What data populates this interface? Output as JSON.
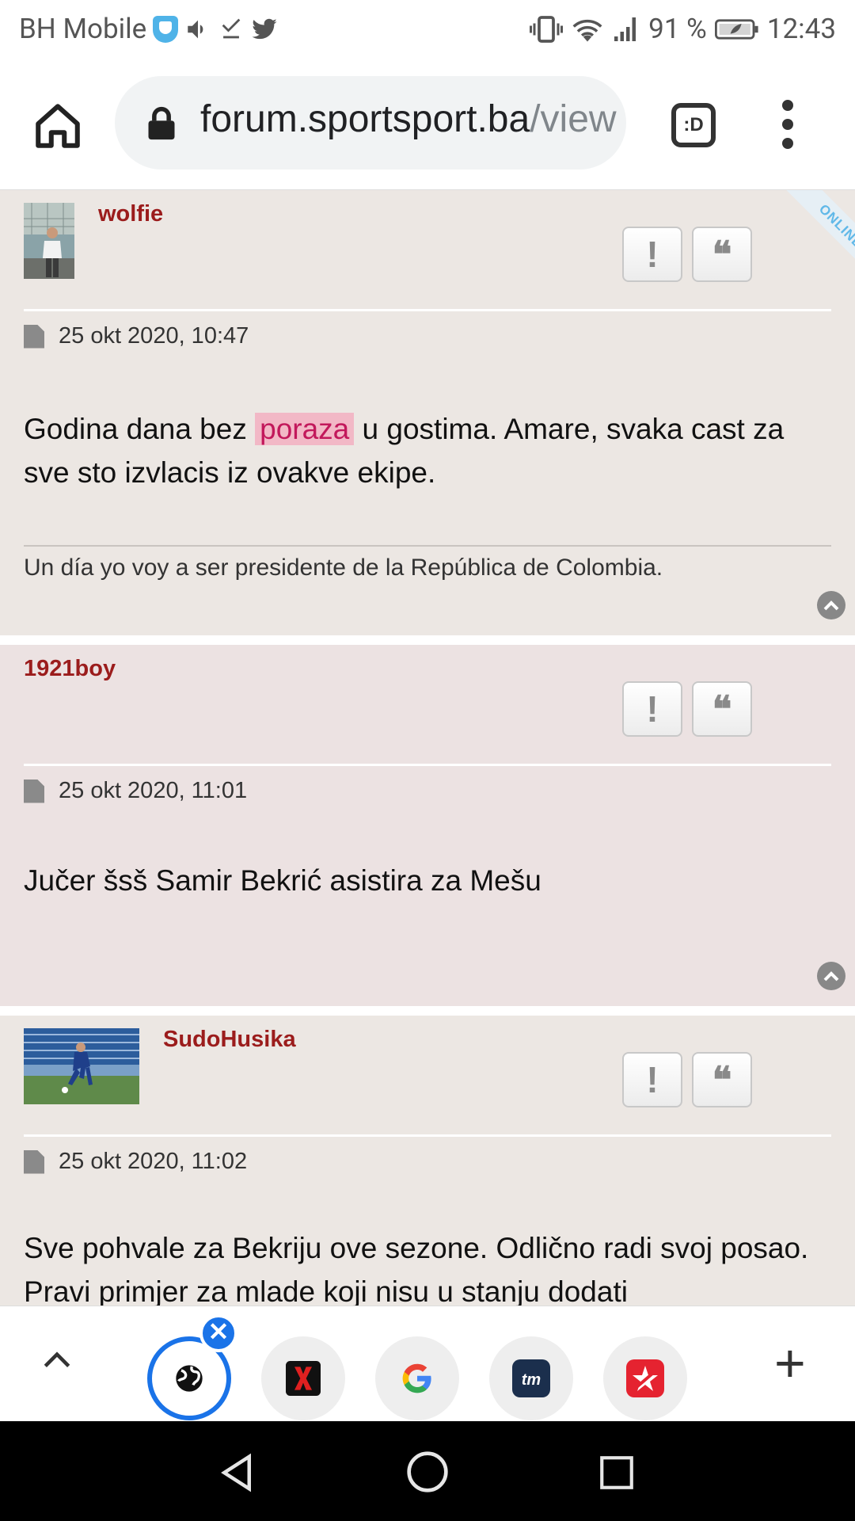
{
  "status_bar": {
    "carrier": "BH Mobile",
    "battery": "91 %",
    "time": "12:43"
  },
  "browser": {
    "url_host": "forum.sportsport.ba",
    "url_path": "/view",
    "tabs_label": ":D"
  },
  "posts": [
    {
      "username": "wolfie",
      "online_badge": "ONLINE",
      "date": "25 okt 2020, 10:47",
      "body_before": "Godina dana bez ",
      "body_highlight": "poraza",
      "body_after": " u gostima. Amare, svaka cast za sve sto izvlacis iz ovakve ekipe.",
      "signature": "Un día yo voy a ser presidente de la República de Colombia."
    },
    {
      "username": "1921boy",
      "date": "25 okt 2020, 11:01",
      "body": "Jučer šsš Samir Bekrić asistira za Mešu"
    },
    {
      "username": "SudoHusika",
      "date": "25 okt 2020, 11:02",
      "body": "Sve pohvale za Bekriju ove sezone. Odlično radi svoj posao. Pravi primjer za mlade koji nisu u stanju dodati"
    }
  ],
  "post_buttons": {
    "report": "!",
    "quote": "❝"
  },
  "bottom_tabs": {
    "close_badge": "✕",
    "add": "+",
    "icons": [
      "globe-icon",
      "x-icon",
      "google-icon",
      "transfermarkt-icon",
      "sport-icon"
    ]
  },
  "colors": {
    "username": "#9b1c1c",
    "accent": "#1a73e8",
    "highlight": "#f2b8c6"
  }
}
